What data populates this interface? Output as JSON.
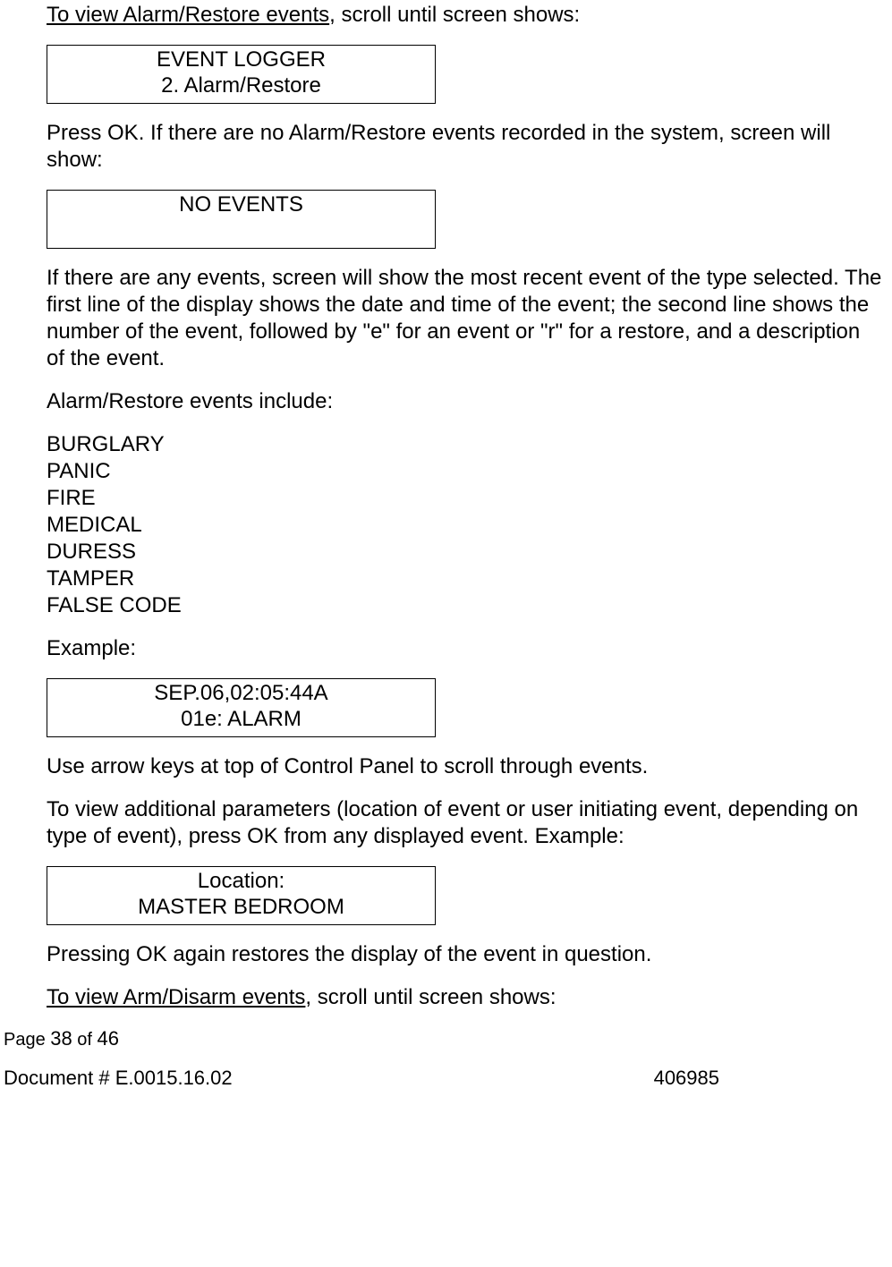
{
  "intro": {
    "lead_underlined": "To view Alarm/Restore events",
    "lead_rest": ", scroll until screen shows:"
  },
  "screen1": {
    "line1": "EVENT LOGGER",
    "line2": "2. Alarm/Restore"
  },
  "para2": "Press OK. If there are no Alarm/Restore events recorded in the system, screen will show:",
  "screen2": {
    "line1": "NO EVENTS",
    "line2": ""
  },
  "para3": "If there are any events, screen will show the most recent event of the type selected. The first line of the display shows the date and time of the event; the second line shows the number of the event, followed by \"e\" for an event or \"r\" for a restore, and a description of the event.",
  "para4": "Alarm/Restore events include:",
  "event_types": [
    "BURGLARY",
    "PANIC",
    "FIRE",
    "MEDICAL",
    "DURESS",
    "TAMPER",
    "FALSE CODE"
  ],
  "example_label": "Example:",
  "screen3": {
    "line1": "SEP.06,02:05:44A",
    "line2": "01e: ALARM"
  },
  "para5": "Use arrow keys at top of Control Panel to scroll through events.",
  "para6": "To view additional parameters (location of event or user initiating event, depending on type of event), press OK from any displayed event. Example:",
  "screen4": {
    "line1": "Location:",
    "line2": "MASTER BEDROOM"
  },
  "para7": "Pressing OK again restores the display of the event in question.",
  "outro": {
    "lead_underlined": "To view Arm/Disarm events",
    "lead_rest": ", scroll until screen shows:"
  },
  "footer": {
    "page_word": "Page ",
    "page_num": "38",
    "of_word": "  of   ",
    "page_total": "46",
    "doc_label": "Document # ",
    "doc_num": "E.0015.16.02",
    "right_num": "406985"
  }
}
